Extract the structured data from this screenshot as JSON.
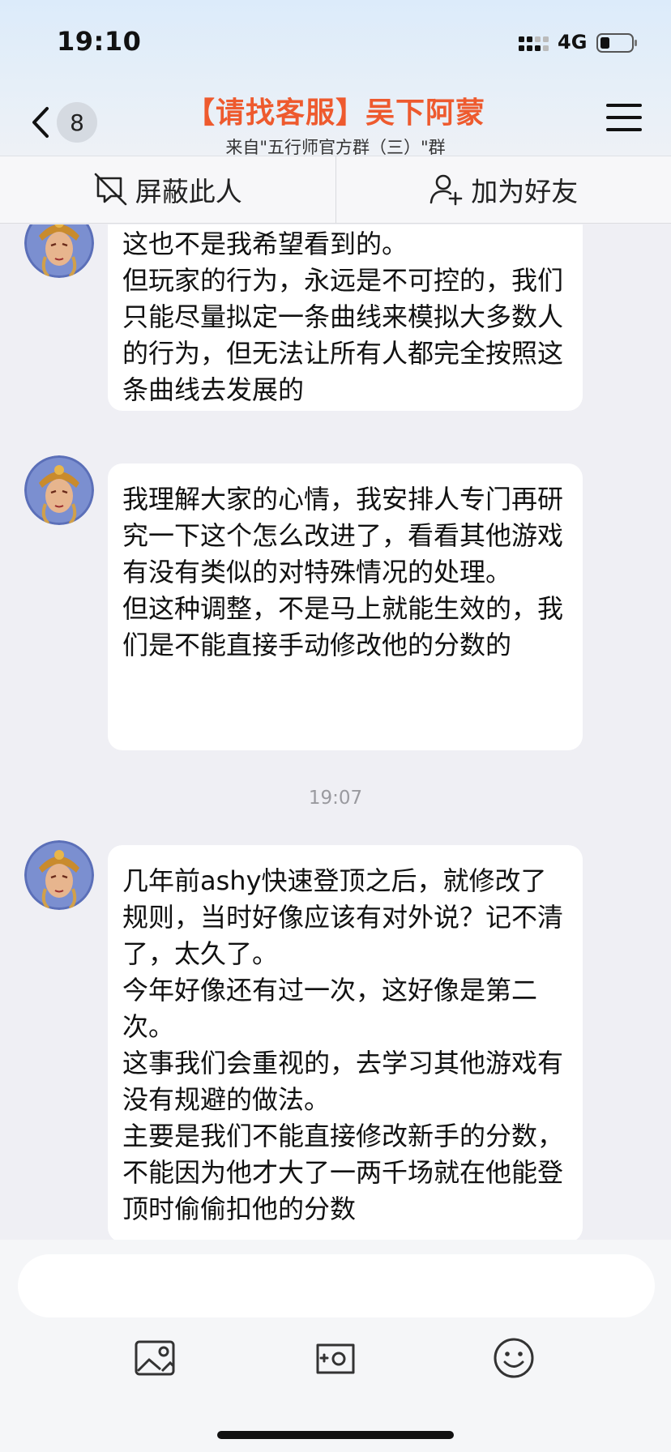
{
  "status_bar": {
    "time": "19:10",
    "network": "4G"
  },
  "header": {
    "unread_count": "8",
    "title": "【请找客服】吴下阿蒙",
    "subtitle": "来自\"五行师官方群（三）\"群",
    "title_color": "#ee5a2e"
  },
  "actions": {
    "block_label": "屏蔽此人",
    "add_friend_label": "加为好友"
  },
  "messages": [
    {
      "text": "这也不是我希望看到的。\n但玩家的行为，永远是不可控的，我们只能尽量拟定一条曲线来模拟大多数人的行为，但无法让所有人都完全按照这条曲线去发展的"
    },
    {
      "text": "我理解大家的心情，我安排人专门再研究一下这个怎么改进了，看看其他游戏有没有类似的对特殊情况的处理。\n但这种调整，不是马上就能生效的，我们是不能直接手动修改他的分数的"
    },
    {
      "text": "几年前ashy快速登顶之后，就修改了规则，当时好像应该有对外说？记不清了，太久了。\n今年好像还有过一次，这好像是第二次。\n这事我们会重视的，去学习其他游戏有没有规避的做法。\n主要是我们不能直接修改新手的分数，不能因为他才大了一两千场就在他能登顶时偷偷扣他的分数"
    }
  ],
  "timestamp": "19:07",
  "input": {
    "value": ""
  },
  "toolbar": {
    "icons": [
      "image-icon",
      "camera-icon",
      "emoji-icon"
    ]
  }
}
